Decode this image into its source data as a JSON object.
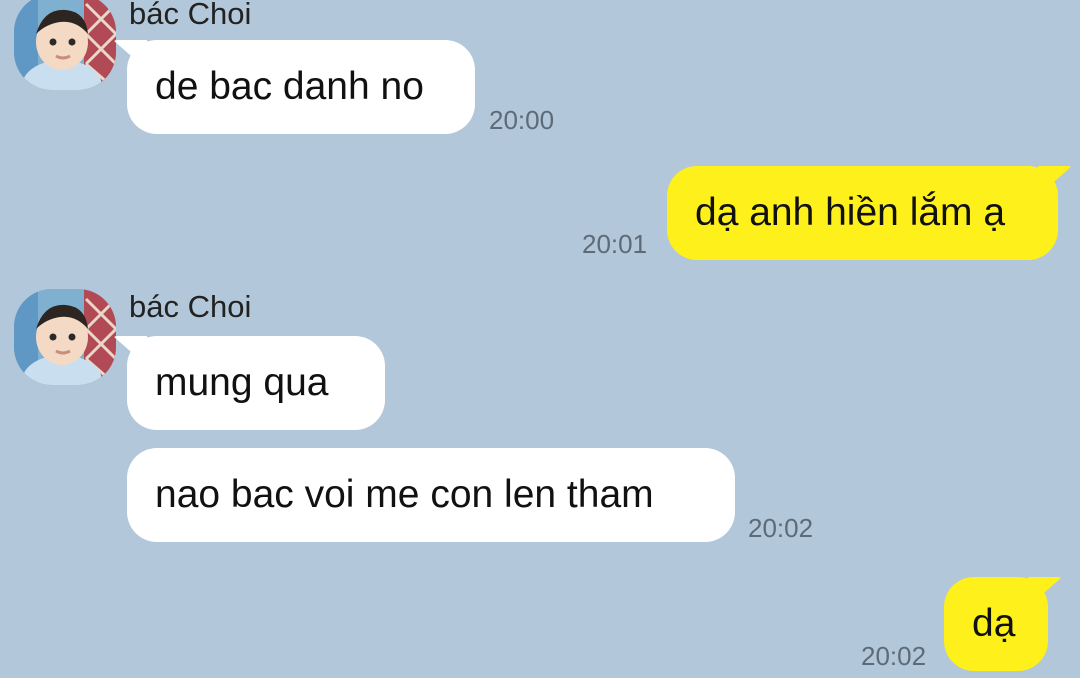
{
  "messages": [
    {
      "sender": "bác Choi",
      "text": "de bac danh no",
      "time": "20:00"
    },
    {
      "text": "dạ anh hiền lắm ạ",
      "time": "20:01"
    },
    {
      "sender": "bác Choi",
      "text": "mung qua"
    },
    {
      "text": "nao bac voi me con len tham",
      "time": "20:02"
    },
    {
      "text": "dạ",
      "time": "20:02"
    }
  ],
  "colors": {
    "background": "#b2c7da",
    "incoming_bubble": "#ffffff",
    "outgoing_bubble": "#fef01b",
    "timestamp": "#5d6b78"
  },
  "icons": {
    "avatar": "baby-profile-photo"
  }
}
